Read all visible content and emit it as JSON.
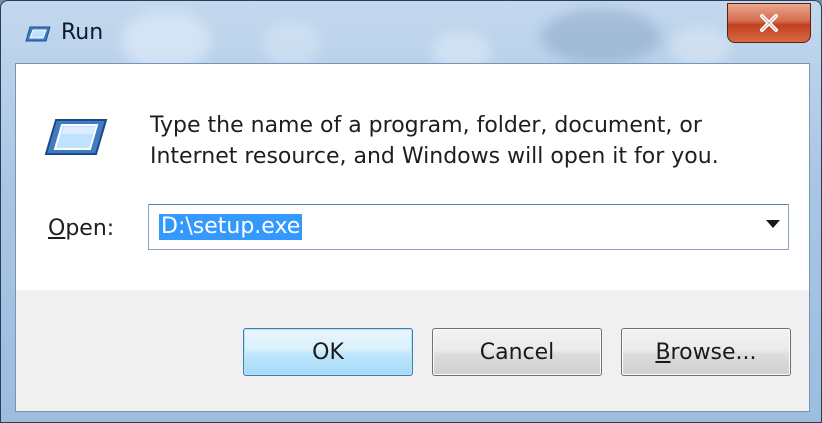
{
  "window": {
    "title": "Run",
    "close_symbol": "x"
  },
  "body": {
    "description": "Type the name of a program, folder, document, or Internet resource, and Windows will open it for you.",
    "open_label_accel": "O",
    "open_label_rest": "pen:",
    "input_value": "D:\\setup.exe"
  },
  "buttons": {
    "ok": "OK",
    "cancel": "Cancel",
    "browse_accel": "B",
    "browse_rest": "rowse..."
  },
  "icons": {
    "title": "run-icon",
    "main": "run-icon",
    "close": "close-icon",
    "dropdown": "chevron-down-icon"
  },
  "colors": {
    "selection": "#3399ff",
    "close_button": "#c1401f",
    "default_button_border": "#3c7fb1"
  }
}
